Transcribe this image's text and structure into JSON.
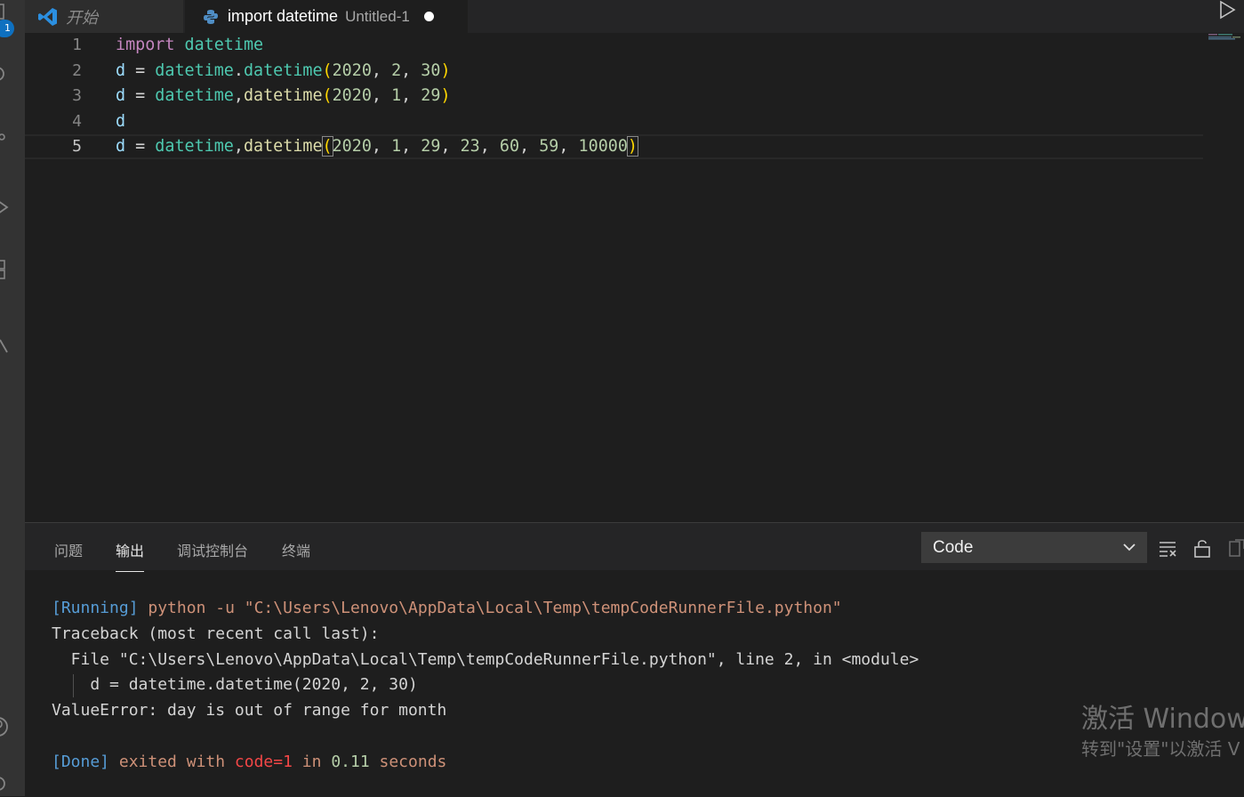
{
  "activity_bar": {
    "badge": "1",
    "icons": [
      "explorer-icon",
      "search-icon",
      "source-control-icon",
      "run-debug-icon",
      "extensions-icon",
      "remote-icon",
      "account-icon",
      "settings-icon"
    ]
  },
  "tabs": [
    {
      "label": "开始",
      "icon": "vscode-logo-icon",
      "active": false
    },
    {
      "label": "import datetime",
      "description": "Untitled-1",
      "icon": "python-icon",
      "active": true,
      "dirty": true
    }
  ],
  "editor": {
    "language": "python",
    "current_line": 5,
    "lines": [
      {
        "number": "1",
        "tokens": [
          {
            "t": "import",
            "c": "kw"
          },
          {
            "t": " ",
            "c": "op"
          },
          {
            "t": "datetime",
            "c": "mod"
          }
        ]
      },
      {
        "number": "2",
        "tokens": [
          {
            "t": "d",
            "c": "var"
          },
          {
            "t": " = ",
            "c": "op"
          },
          {
            "t": "datetime",
            "c": "mod"
          },
          {
            "t": ".",
            "c": "op"
          },
          {
            "t": "datetime",
            "c": "mod"
          },
          {
            "t": "(",
            "c": "br"
          },
          {
            "t": "2020",
            "c": "num"
          },
          {
            "t": ", ",
            "c": "op"
          },
          {
            "t": "2",
            "c": "num"
          },
          {
            "t": ", ",
            "c": "op"
          },
          {
            "t": "30",
            "c": "num"
          },
          {
            "t": ")",
            "c": "br"
          }
        ]
      },
      {
        "number": "3",
        "tokens": [
          {
            "t": "d",
            "c": "var"
          },
          {
            "t": " = ",
            "c": "op"
          },
          {
            "t": "datetime",
            "c": "mod"
          },
          {
            "t": ",",
            "c": "op"
          },
          {
            "t": "datetime",
            "c": "fn"
          },
          {
            "t": "(",
            "c": "br"
          },
          {
            "t": "2020",
            "c": "num"
          },
          {
            "t": ", ",
            "c": "op"
          },
          {
            "t": "1",
            "c": "num"
          },
          {
            "t": ", ",
            "c": "op"
          },
          {
            "t": "29",
            "c": "num"
          },
          {
            "t": ")",
            "c": "br"
          }
        ]
      },
      {
        "number": "4",
        "tokens": [
          {
            "t": "d",
            "c": "var"
          }
        ]
      },
      {
        "number": "5",
        "tokens": [
          {
            "t": "d",
            "c": "var"
          },
          {
            "t": " = ",
            "c": "op"
          },
          {
            "t": "datetime",
            "c": "mod"
          },
          {
            "t": ",",
            "c": "op"
          },
          {
            "t": "datetime",
            "c": "fn"
          },
          {
            "t": "(",
            "c": "br brm"
          },
          {
            "t": "2020",
            "c": "num"
          },
          {
            "t": ", ",
            "c": "op"
          },
          {
            "t": "1",
            "c": "num"
          },
          {
            "t": ", ",
            "c": "op"
          },
          {
            "t": "29",
            "c": "num"
          },
          {
            "t": ", ",
            "c": "op"
          },
          {
            "t": "23",
            "c": "num"
          },
          {
            "t": ", ",
            "c": "op"
          },
          {
            "t": "60",
            "c": "num"
          },
          {
            "t": ", ",
            "c": "op"
          },
          {
            "t": "59",
            "c": "num"
          },
          {
            "t": ", ",
            "c": "op"
          },
          {
            "t": "10000",
            "c": "num"
          },
          {
            "t": ")",
            "c": "br brm"
          }
        ]
      }
    ]
  },
  "panel": {
    "tabs": [
      "问题",
      "输出",
      "调试控制台",
      "终端"
    ],
    "active_tab": "输出",
    "output_channel": "Code",
    "output_lines": [
      {
        "indent": false,
        "guide": false,
        "segments": [
          {
            "t": "[Running]",
            "c": "o-blue"
          },
          {
            "t": " python -u \"C:\\Users\\Lenovo\\AppData\\Local\\Temp\\tempCodeRunnerFile.python\"",
            "c": "o-orange"
          }
        ]
      },
      {
        "indent": false,
        "guide": false,
        "segments": [
          {
            "t": "Traceback (most recent call last):",
            "c": ""
          }
        ]
      },
      {
        "indent": false,
        "guide": false,
        "segments": [
          {
            "t": "  File \"C:\\Users\\Lenovo\\AppData\\Local\\Temp\\tempCodeRunnerFile.python\", line 2, in <module>",
            "c": ""
          }
        ]
      },
      {
        "indent": false,
        "guide": true,
        "segments": [
          {
            "t": "    d = datetime.datetime(2020, 2, 30)",
            "c": ""
          }
        ]
      },
      {
        "indent": false,
        "guide": false,
        "segments": [
          {
            "t": "ValueError: day is out of range for month",
            "c": ""
          }
        ]
      },
      {
        "indent": false,
        "guide": false,
        "segments": [
          {
            "t": "",
            "c": ""
          }
        ]
      },
      {
        "indent": false,
        "guide": false,
        "segments": [
          {
            "t": "[Done]",
            "c": "o-blue"
          },
          {
            "t": " exited with ",
            "c": "o-orange"
          },
          {
            "t": "code=1",
            "c": "o-red"
          },
          {
            "t": " in ",
            "c": "o-orange"
          },
          {
            "t": "0.11",
            "c": "o-num"
          },
          {
            "t": " seconds",
            "c": "o-orange"
          }
        ]
      }
    ]
  },
  "watermark": {
    "title": "激活 Window",
    "subtitle": "转到\"设置\"以激活 V"
  },
  "colors": {
    "editor_bg": "#1e1e1e",
    "tab_bar_bg": "#252526",
    "badge": "#0e70c0",
    "keyword": "#c586c0",
    "module": "#4ec9b0",
    "variable": "#9cdcfe",
    "function": "#dcdcaa",
    "number": "#b5cea8",
    "bracket": "#ffd700"
  }
}
